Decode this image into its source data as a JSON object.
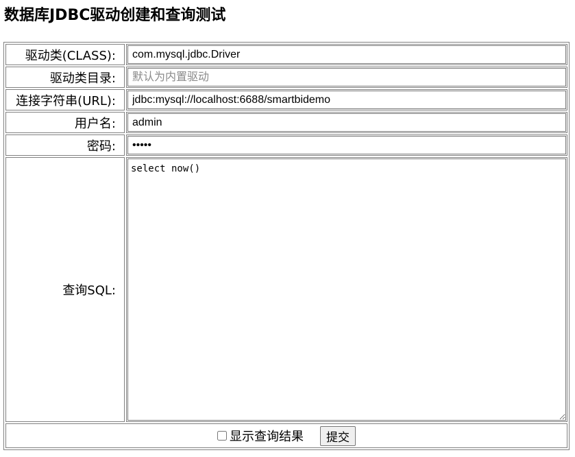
{
  "page": {
    "title": "数据库JDBC驱动创建和查询测试"
  },
  "form": {
    "driver_class": {
      "label": "驱动类(CLASS):",
      "value": "com.mysql.jdbc.Driver",
      "placeholder": ""
    },
    "driver_dir": {
      "label": "驱动类目录:",
      "value": "",
      "placeholder": "默认为内置驱动"
    },
    "url": {
      "label": "连接字符串(URL):",
      "value": "jdbc:mysql://localhost:6688/smartbidemo",
      "placeholder": ""
    },
    "username": {
      "label": "用户名:",
      "value": "admin",
      "placeholder": ""
    },
    "password": {
      "label": "密码:",
      "value": "•••••",
      "placeholder": ""
    },
    "sql": {
      "label": "查询SQL:",
      "value": "select now()"
    },
    "show_result": {
      "label": "显示查询结果",
      "checked": false
    },
    "submit_label": "提交"
  }
}
